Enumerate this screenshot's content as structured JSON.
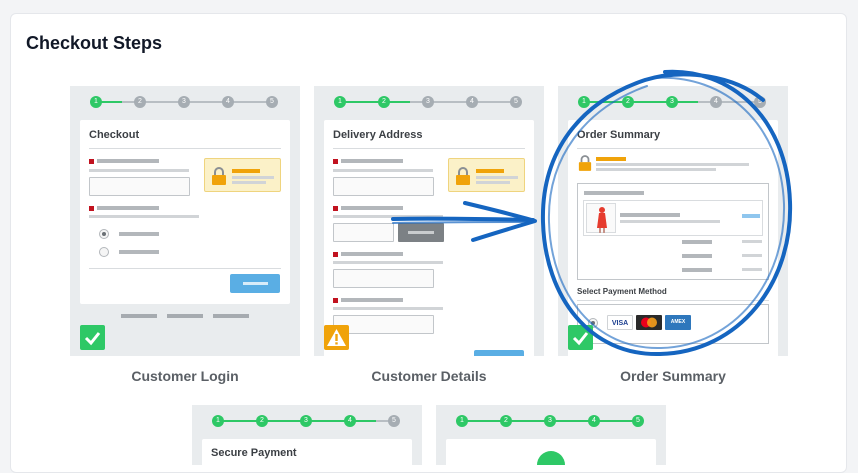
{
  "page": {
    "title": "Checkout Steps"
  },
  "panels": {
    "login": {
      "caption": "Customer Login",
      "form_title": "Checkout",
      "steps": [
        "1",
        "2",
        "3",
        "4",
        "5"
      ],
      "status": "complete"
    },
    "details": {
      "caption": "Customer Details",
      "form_title": "Delivery Address",
      "steps": [
        "1",
        "2",
        "3",
        "4",
        "5"
      ],
      "status": "warning"
    },
    "summary": {
      "caption": "Order Summary",
      "form_title": "Order Summary",
      "payment_label": "Select Payment Method",
      "card_brands": [
        "VISA",
        "MasterCard",
        "AMEX"
      ],
      "steps": [
        "1",
        "2",
        "3",
        "4",
        "5"
      ],
      "status": "complete"
    },
    "payment": {
      "form_title": "Secure Payment",
      "steps": [
        "1",
        "2",
        "3",
        "4",
        "5"
      ]
    },
    "confirmation": {
      "steps": [
        "1",
        "2",
        "3",
        "4",
        "5"
      ]
    }
  },
  "colors": {
    "step_done": "#2ec866",
    "step_pending": "#a6adb3",
    "button": "#5aaee4",
    "annotation": "#1565c0",
    "warning": "#f0a30a"
  },
  "icons": [
    "lock-icon",
    "check-icon",
    "warning-icon",
    "arrow-annotation",
    "circle-annotation"
  ]
}
